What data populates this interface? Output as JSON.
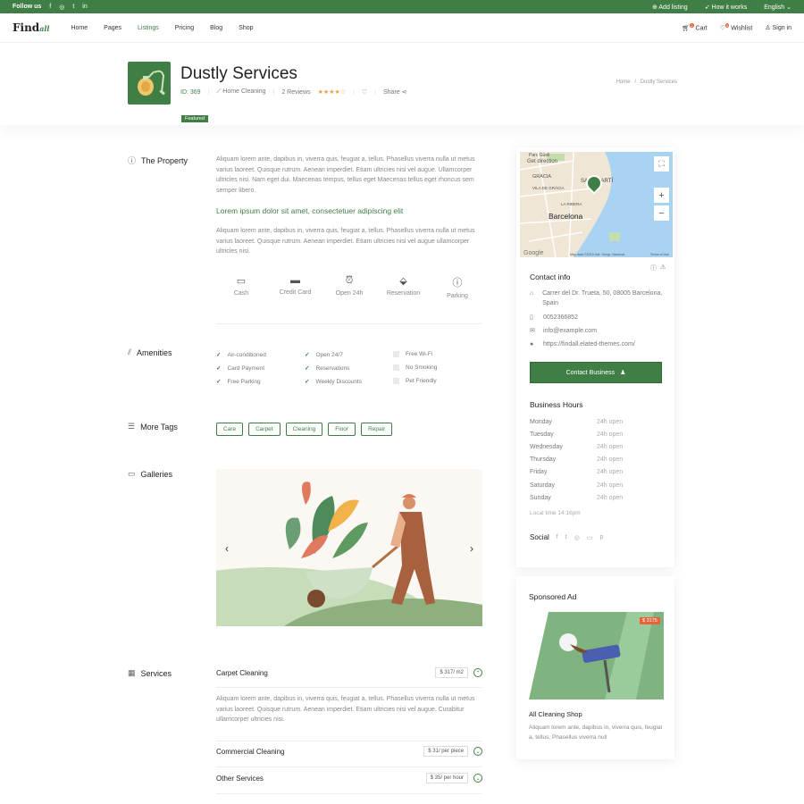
{
  "topbar": {
    "follow": "Follow us",
    "add_listing": "Add listing",
    "how_it_works": "How it works",
    "language": "English"
  },
  "nav": {
    "logo": "Find",
    "logo_script": "all",
    "items": [
      "Home",
      "Pages",
      "Listings",
      "Pricing",
      "Blog",
      "Shop"
    ],
    "cart": "Cart",
    "cart_count": "0",
    "wishlist": "Wishlist",
    "wishlist_count": "0",
    "signin": "Sign in"
  },
  "listing": {
    "title": "Dustly Services",
    "id": "ID: 369",
    "category": "Home Cleaning",
    "reviews": "2 Reviews",
    "rating": 4,
    "share": "Share",
    "breadcrumb_home": "Home",
    "breadcrumb_sep": "/",
    "breadcrumb_current": "Dustly Services",
    "badge": "Featured"
  },
  "property": {
    "title": "The Property",
    "para1": "Aliquam lorem ante, dapibus in, viverra quis, feugiat a, tellus. Phasellus viverra nulla ut metus varius laoreet. Quisque rutrum. Aenean imperdiet. Etiam ultricies nisi vel augue. Ullamcorper ultricies nisi. Nam eget dui. Maecenas tempus, tellus eget Maecenas tellus eget rhoncus sem semper libero.",
    "heading": "Lorem ipsum dolor sit amet, consectetuer adipiscing elit",
    "para2": "Aliquam lorem ante, dapibus in, viverra quis, feugiat a, tellus. Phasellus viverra nulla ut metus varius laoreet. Quisque rutrum. Aenean imperdiet. Etiam ultricies nisi vel augue ullamcorper ultricies nisi.",
    "payments": [
      "Cash",
      "Credit Card",
      "Open 24h",
      "Reservation",
      "Parking"
    ]
  },
  "amenities": {
    "title": "Amenities",
    "items": [
      {
        "label": "Air-conditioned",
        "on": true
      },
      {
        "label": "Open 24/7",
        "on": true
      },
      {
        "label": "Free Wi-Fi",
        "on": false
      },
      {
        "label": "Card Payment",
        "on": true
      },
      {
        "label": "Reservations",
        "on": true
      },
      {
        "label": "No Smoking",
        "on": false
      },
      {
        "label": "Free Parking",
        "on": true
      },
      {
        "label": "Weekly Discounts",
        "on": true
      },
      {
        "label": "Pet Friendly",
        "on": false
      }
    ]
  },
  "tags": {
    "title": "More Tags",
    "items": [
      "Care",
      "Carpet",
      "Cleaning",
      "Floor",
      "Repair"
    ]
  },
  "galleries": {
    "title": "Galleries"
  },
  "services": {
    "title": "Services",
    "items": [
      {
        "name": "Carpet Cleaning",
        "price": "$ 317/ m2",
        "open": true
      },
      {
        "name": "Commercial Cleaning",
        "price": "$ 31/ per piece",
        "open": false
      },
      {
        "name": "Other Services",
        "price": "$ 35/ per hour",
        "open": false
      }
    ],
    "desc": "Aliquam lorem ante, dapibus in, viverra quis, feugiat a, tellus. Phasellus viverra nulla ut metus varius laoreet. Quisque rutrum. Aenean imperdiet. Etiam ultricies nisi vel augue. Curabitur ullamcorper ultricies nisi."
  },
  "map": {
    "get_direction": "Get direction",
    "labels": [
      "Parc Güell",
      "GRÀCIA",
      "SANT MARTÍ",
      "VILA DE GRÀCIA",
      "Barcelona",
      "LA RIBERA"
    ],
    "attribution": "Map data ©2019 Inst. Geogr. Nacional",
    "terms": "Terms of Use",
    "google": "Google"
  },
  "contact": {
    "title": "Contact info",
    "address": "Carrer del Dr. Trueta, 50, 08005 Barcelona, Spain",
    "phone": "0052366852",
    "email": "info@example.com",
    "website": "https://findall.elated-themes.com/",
    "button": "Contact Business"
  },
  "hours": {
    "title": "Business Hours",
    "days": [
      {
        "day": "Monday",
        "time": "24h open"
      },
      {
        "day": "Tuesday",
        "time": "24h open"
      },
      {
        "day": "Wednesday",
        "time": "24h open"
      },
      {
        "day": "Thursday",
        "time": "24h open"
      },
      {
        "day": "Friday",
        "time": "24h open"
      },
      {
        "day": "Saturday",
        "time": "24h open"
      },
      {
        "day": "Sunday",
        "time": "24h open"
      }
    ],
    "local_time": "Local time 14:16pm"
  },
  "social": {
    "title": "Social"
  },
  "ad": {
    "title": "Sponsored Ad",
    "price": "$ 3175",
    "name": "All Cleaning Shop",
    "desc": "Aliquam lorem ante, dapibus in, viverra quis, feugiat a, tellus. Phasellus viverra null"
  },
  "colors": {
    "accent": "#3f7f45",
    "star": "#e8a33b"
  }
}
